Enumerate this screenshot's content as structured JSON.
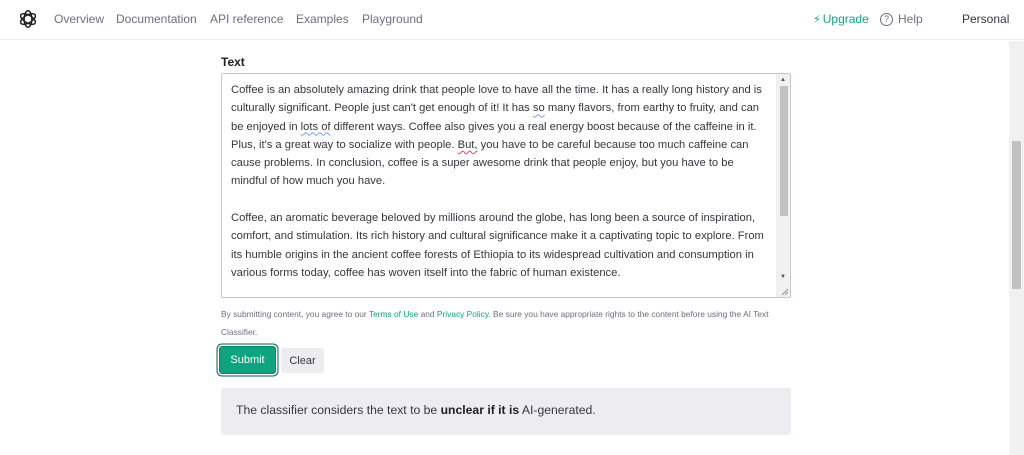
{
  "nav": {
    "items": [
      "Overview",
      "Documentation",
      "API reference",
      "Examples",
      "Playground"
    ],
    "upgrade": "Upgrade",
    "help": "Help",
    "personal": "Personal"
  },
  "form": {
    "label": "Text",
    "paragraph1": {
      "s1": "Coffee is an absolutely amazing drink that people love to have all the time. It has a really long history and is culturally significant. People just can't get enough of it! It has ",
      "w1": "so",
      "s2": " many flavors, from earthy to fruity, and can be enjoyed in ",
      "w2": "lots of",
      "s3": " different ways. Coffee also gives you a real energy boost because of the caffeine in it. Plus, it's a great way to socialize with people. ",
      "w3": "But,",
      "s4": " you have to be careful because too much caffeine can cause problems. In conclusion, coffee is a super awesome drink that people enjoy, but you have to be mindful of how much you have."
    },
    "paragraph2": "Coffee, an aromatic beverage beloved by millions around the globe, has long been a source of inspiration, comfort, and stimulation. Its rich history and cultural significance make it a captivating topic to explore. From its humble origins in the ancient coffee forests of Ethiopia to its widespread cultivation and consumption in various forms today, coffee has woven itself into the fabric of human existence.",
    "disclaimer": {
      "pre": "By submitting content, you agree to our ",
      "terms": "Terms of Use",
      "and": " and ",
      "privacy": "Privacy Policy",
      "post": ". Be sure you have appropriate rights to the content before using the AI Text Classifier."
    },
    "submit_label": "Submit",
    "clear_label": "Clear"
  },
  "result": {
    "pre": "The classifier considers the text to be ",
    "bold": "unclear if it is",
    "post": " AI-generated."
  },
  "colors": {
    "accent": "#10a37f",
    "result_bg": "#ececf1"
  },
  "icons": {
    "logo": "openai-logo-icon",
    "upgrade": "lightning-bolt-icon",
    "help": "question-circle-icon"
  }
}
